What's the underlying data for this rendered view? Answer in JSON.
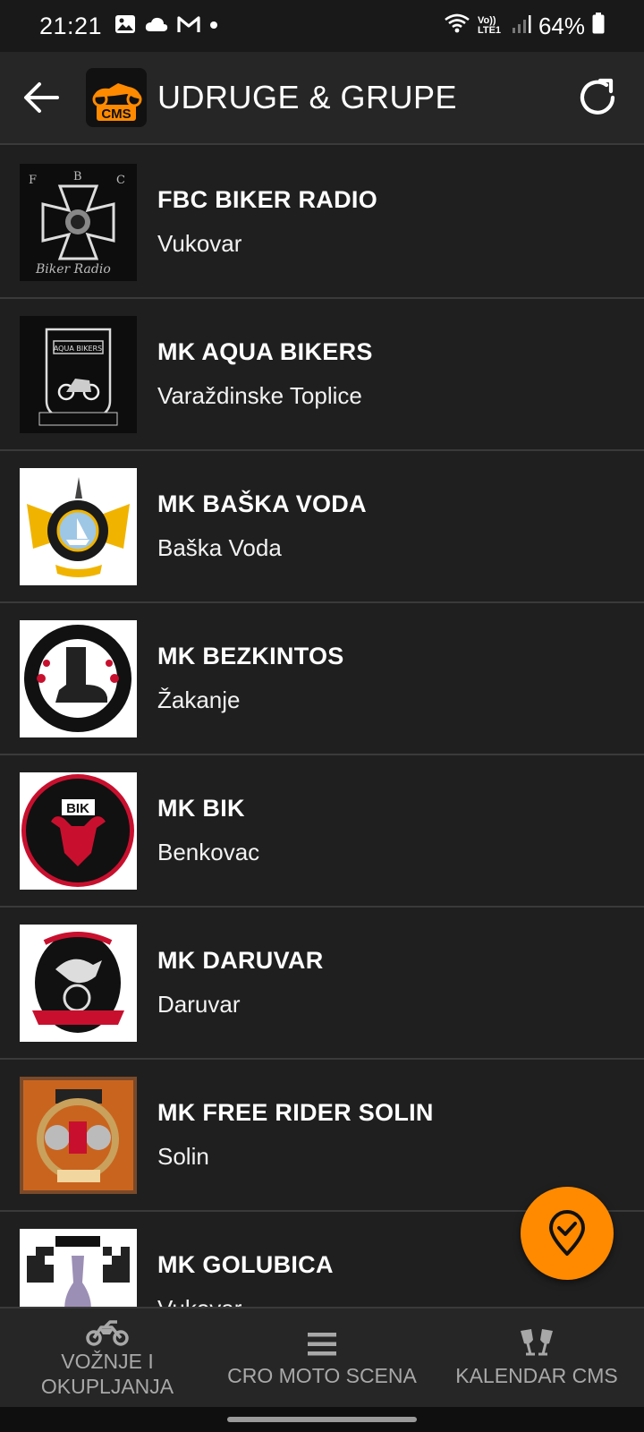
{
  "status": {
    "time": "21:21",
    "network": "Vo)) LTE1",
    "battery": "64%"
  },
  "appbar": {
    "title": "UDRUGE & GRUPE",
    "logo_text": "CMS"
  },
  "items": [
    {
      "name": "FBC BIKER RADIO",
      "city": "Vukovar",
      "icon": "fbc-biker-radio-logo"
    },
    {
      "name": "MK AQUA BIKERS",
      "city": "Varaždinske Toplice",
      "icon": "aqua-bikers-logo"
    },
    {
      "name": "MK BAŠKA VODA",
      "city": "Baška Voda",
      "icon": "baska-voda-logo"
    },
    {
      "name": "MK BEZKINTOS",
      "city": "Žakanje",
      "icon": "bezkintos-logo"
    },
    {
      "name": "MK BIK",
      "city": "Benkovac",
      "icon": "bik-logo"
    },
    {
      "name": "MK DARUVAR",
      "city": "Daruvar",
      "icon": "daruvar-logo"
    },
    {
      "name": "MK FREE RIDER SOLIN",
      "city": "Solin",
      "icon": "free-rider-solin-logo"
    },
    {
      "name": "MK GOLUBICA",
      "city": "Vukovar",
      "icon": "golubica-logo"
    }
  ],
  "nav": [
    {
      "label": "VOŽNJE I OKUPLJANJA",
      "icon": "motorcycle-icon"
    },
    {
      "label": "CRO MOTO SCENA",
      "icon": "menu-lines-icon"
    },
    {
      "label": "KALENDAR CMS",
      "icon": "cheers-icon"
    }
  ],
  "colors": {
    "accent": "#ff8a00",
    "background": "#1e1e1e",
    "appbar": "#262626",
    "nav_inactive": "#a8a8a8"
  }
}
